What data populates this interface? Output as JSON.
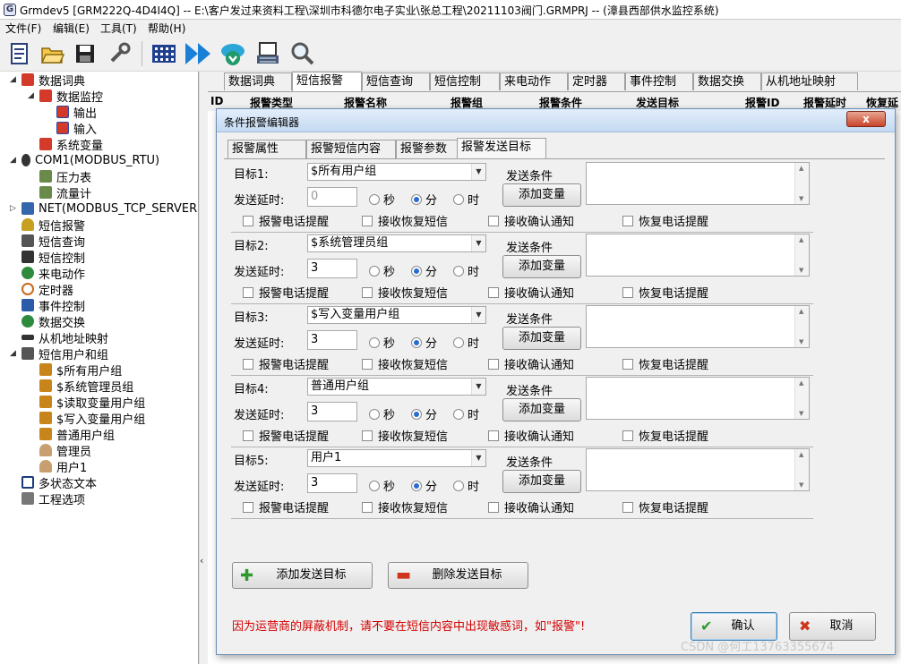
{
  "window": {
    "title": "Grmdev5 [GRM222Q-4D4I4Q]  -- E:\\客户发过来资料工程\\深圳市科德尔电子实业\\张总工程\\20211103阀门.GRMPRJ -- (漳县西部供水监控系统)",
    "app_icon_letter": "G"
  },
  "menu": [
    "文件(F)",
    "编辑(E)",
    "工具(T)",
    "帮助(H)"
  ],
  "toolbar": [
    "new-file-icon",
    "open-folder-icon",
    "save-icon",
    "settings-tools-icon",
    "grid-icon",
    "run-icon",
    "download-icon",
    "device-icon",
    "search-icon"
  ],
  "tree": [
    {
      "label": "数据词典",
      "color": "#d43a2a",
      "expander": "◢"
    },
    {
      "label": "数据监控",
      "color": "#d43a2a",
      "expander": "◢"
    },
    {
      "label": "输出",
      "color": "#d43a2a"
    },
    {
      "label": "输入",
      "color": "#d43a2a"
    },
    {
      "label": "系统变量",
      "color": "#d43a2a"
    },
    {
      "label": "COM1(MODBUS_RTU)",
      "color": "#333333",
      "expander": "◢"
    },
    {
      "label": "压力表",
      "color": "#6a8a4a"
    },
    {
      "label": "流量计",
      "color": "#6a8a4a"
    },
    {
      "label": "NET(MODBUS_TCP_SERVER)",
      "color": "#3366aa",
      "expander": "▷"
    },
    {
      "label": "短信报警",
      "color": "#c8a020"
    },
    {
      "label": "短信查询",
      "color": "#555555"
    },
    {
      "label": "短信控制",
      "color": "#333333"
    },
    {
      "label": "来电动作",
      "color": "#2e8b3e"
    },
    {
      "label": "定时器",
      "color": "#c86a1a"
    },
    {
      "label": "事件控制",
      "color": "#2a5caa"
    },
    {
      "label": "数据交换",
      "color": "#2e8b3e"
    },
    {
      "label": "从机地址映射",
      "color": "#333333"
    },
    {
      "label": "短信用户和组",
      "color": "#555555",
      "expander": "◢"
    },
    {
      "label": "$所有用户组",
      "color": "#c8861a"
    },
    {
      "label": "$系统管理员组",
      "color": "#c8861a"
    },
    {
      "label": "$读取变量用户组",
      "color": "#c8861a"
    },
    {
      "label": "$写入变量用户组",
      "color": "#c8861a"
    },
    {
      "label": "普通用户组",
      "color": "#c8861a"
    },
    {
      "label": "管理员",
      "color": "#c8a070"
    },
    {
      "label": "用户1",
      "color": "#c8a070"
    },
    {
      "label": "多状态文本",
      "color": "#1a3a7a"
    },
    {
      "label": "工程选项",
      "color": "#777777"
    }
  ],
  "main_tabs": [
    "数据词典",
    "短信报警",
    "短信查询",
    "短信控制",
    "来电动作",
    "定时器",
    "事件控制",
    "数据交换",
    "从机地址映射"
  ],
  "active_main_tab": 1,
  "grid_headers": [
    "ID",
    "报警类型",
    "报警名称",
    "报警组",
    "报警条件",
    "发送目标",
    "报警ID",
    "报警延时",
    "恢复延"
  ],
  "dialog": {
    "title": "条件报警编辑器",
    "close_label": "x",
    "tabs": [
      "报警属性",
      "报警短信内容",
      "报警参数",
      "报警发送目标"
    ],
    "active_tab": 3,
    "targets": [
      {
        "label": "目标1:",
        "group": "$所有用户组",
        "delay_label": "发送延时:",
        "delay": "",
        "delay_placeholder": "0",
        "unit_selected": "分"
      },
      {
        "label": "目标2:",
        "group": "$系统管理员组",
        "delay_label": "发送延时:",
        "delay": "3",
        "delay_placeholder": "",
        "unit_selected": "分"
      },
      {
        "label": "目标3:",
        "group": "$写入变量用户组",
        "delay_label": "发送延时:",
        "delay": "3",
        "delay_placeholder": "",
        "unit_selected": "分"
      },
      {
        "label": "目标4:",
        "group": "普通用户组",
        "delay_label": "发送延时:",
        "delay": "3",
        "delay_placeholder": "",
        "unit_selected": "分"
      },
      {
        "label": "目标5:",
        "group": "用户1",
        "delay_label": "发送延时:",
        "delay": "3",
        "delay_placeholder": "",
        "unit_selected": "分"
      }
    ],
    "units": [
      "秒",
      "分",
      "时"
    ],
    "checkboxes": [
      "报警电话提醒",
      "接收恢复短信",
      "接收确认通知",
      "恢复电话提醒"
    ],
    "send_condition_label": "发送条件",
    "add_variable_label": "添加变量",
    "add_target_label": "添加发送目标",
    "delete_target_label": "删除发送目标",
    "warning": "因为运营商的屏蔽机制，请不要在短信内容中出现敏感词，如\"报警\"!",
    "ok_label": "确认",
    "cancel_label": "取消"
  },
  "watermark": "CSDN @何工13763355674"
}
